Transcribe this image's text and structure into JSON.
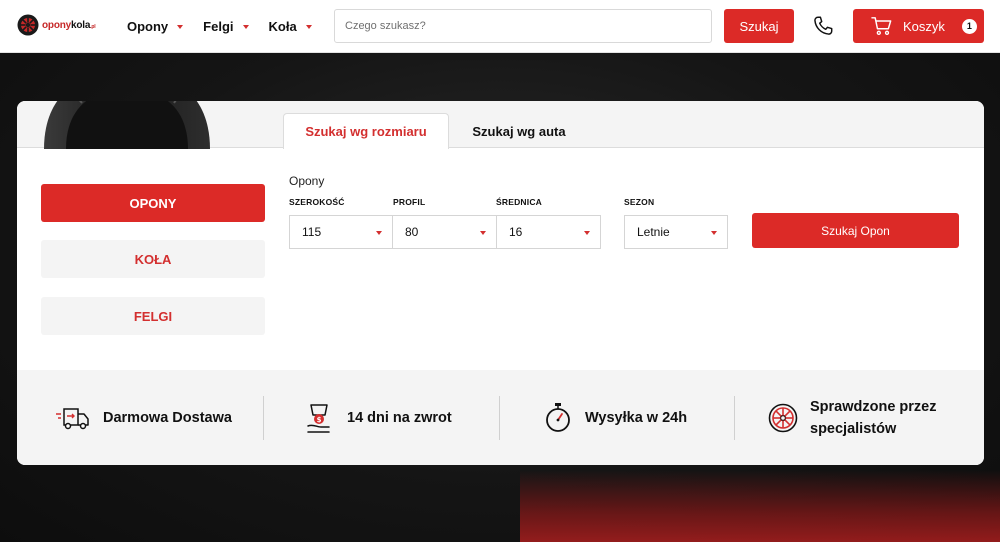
{
  "brand": {
    "logo_main": "opony",
    "logo_accent": "kola",
    "logo_suffix": ".pl"
  },
  "nav": [
    {
      "label": "Opony"
    },
    {
      "label": "Felgi"
    },
    {
      "label": "Koła"
    }
  ],
  "search": {
    "placeholder": "Czego szukasz?",
    "button_label": "Szukaj"
  },
  "cart": {
    "label": "Koszyk",
    "count": "1"
  },
  "tabs": [
    {
      "label": "Szukaj wg rozmiaru",
      "active": true
    },
    {
      "label": "Szukaj wg auta",
      "active": false
    }
  ],
  "sidebar": [
    {
      "label": "OPONY",
      "active": true
    },
    {
      "label": "KOŁA",
      "active": false
    },
    {
      "label": "FELGI",
      "active": false
    }
  ],
  "form": {
    "heading": "Opony",
    "fields": [
      {
        "label": "SZEROKOŚĆ",
        "value": "115"
      },
      {
        "label": "PROFIL",
        "value": "80"
      },
      {
        "label": "ŚREDNICA",
        "value": "16"
      },
      {
        "label": "SEZON",
        "value": "Letnie"
      }
    ],
    "submit_label": "Szukaj Opon"
  },
  "features": [
    {
      "icon": "delivery-truck-icon",
      "text": "Darmowa Dostawa"
    },
    {
      "icon": "money-return-icon",
      "text": "14 dni na zwrot"
    },
    {
      "icon": "stopwatch-icon",
      "text": "Wysyłka w 24h"
    },
    {
      "icon": "wheel-rim-icon",
      "text_line1": "Sprawdzone przez",
      "text_line2": "specjalistów"
    }
  ],
  "colors": {
    "accent": "#dc2a27",
    "accent_text": "#d32f2f",
    "panel": "#f4f4f4"
  }
}
